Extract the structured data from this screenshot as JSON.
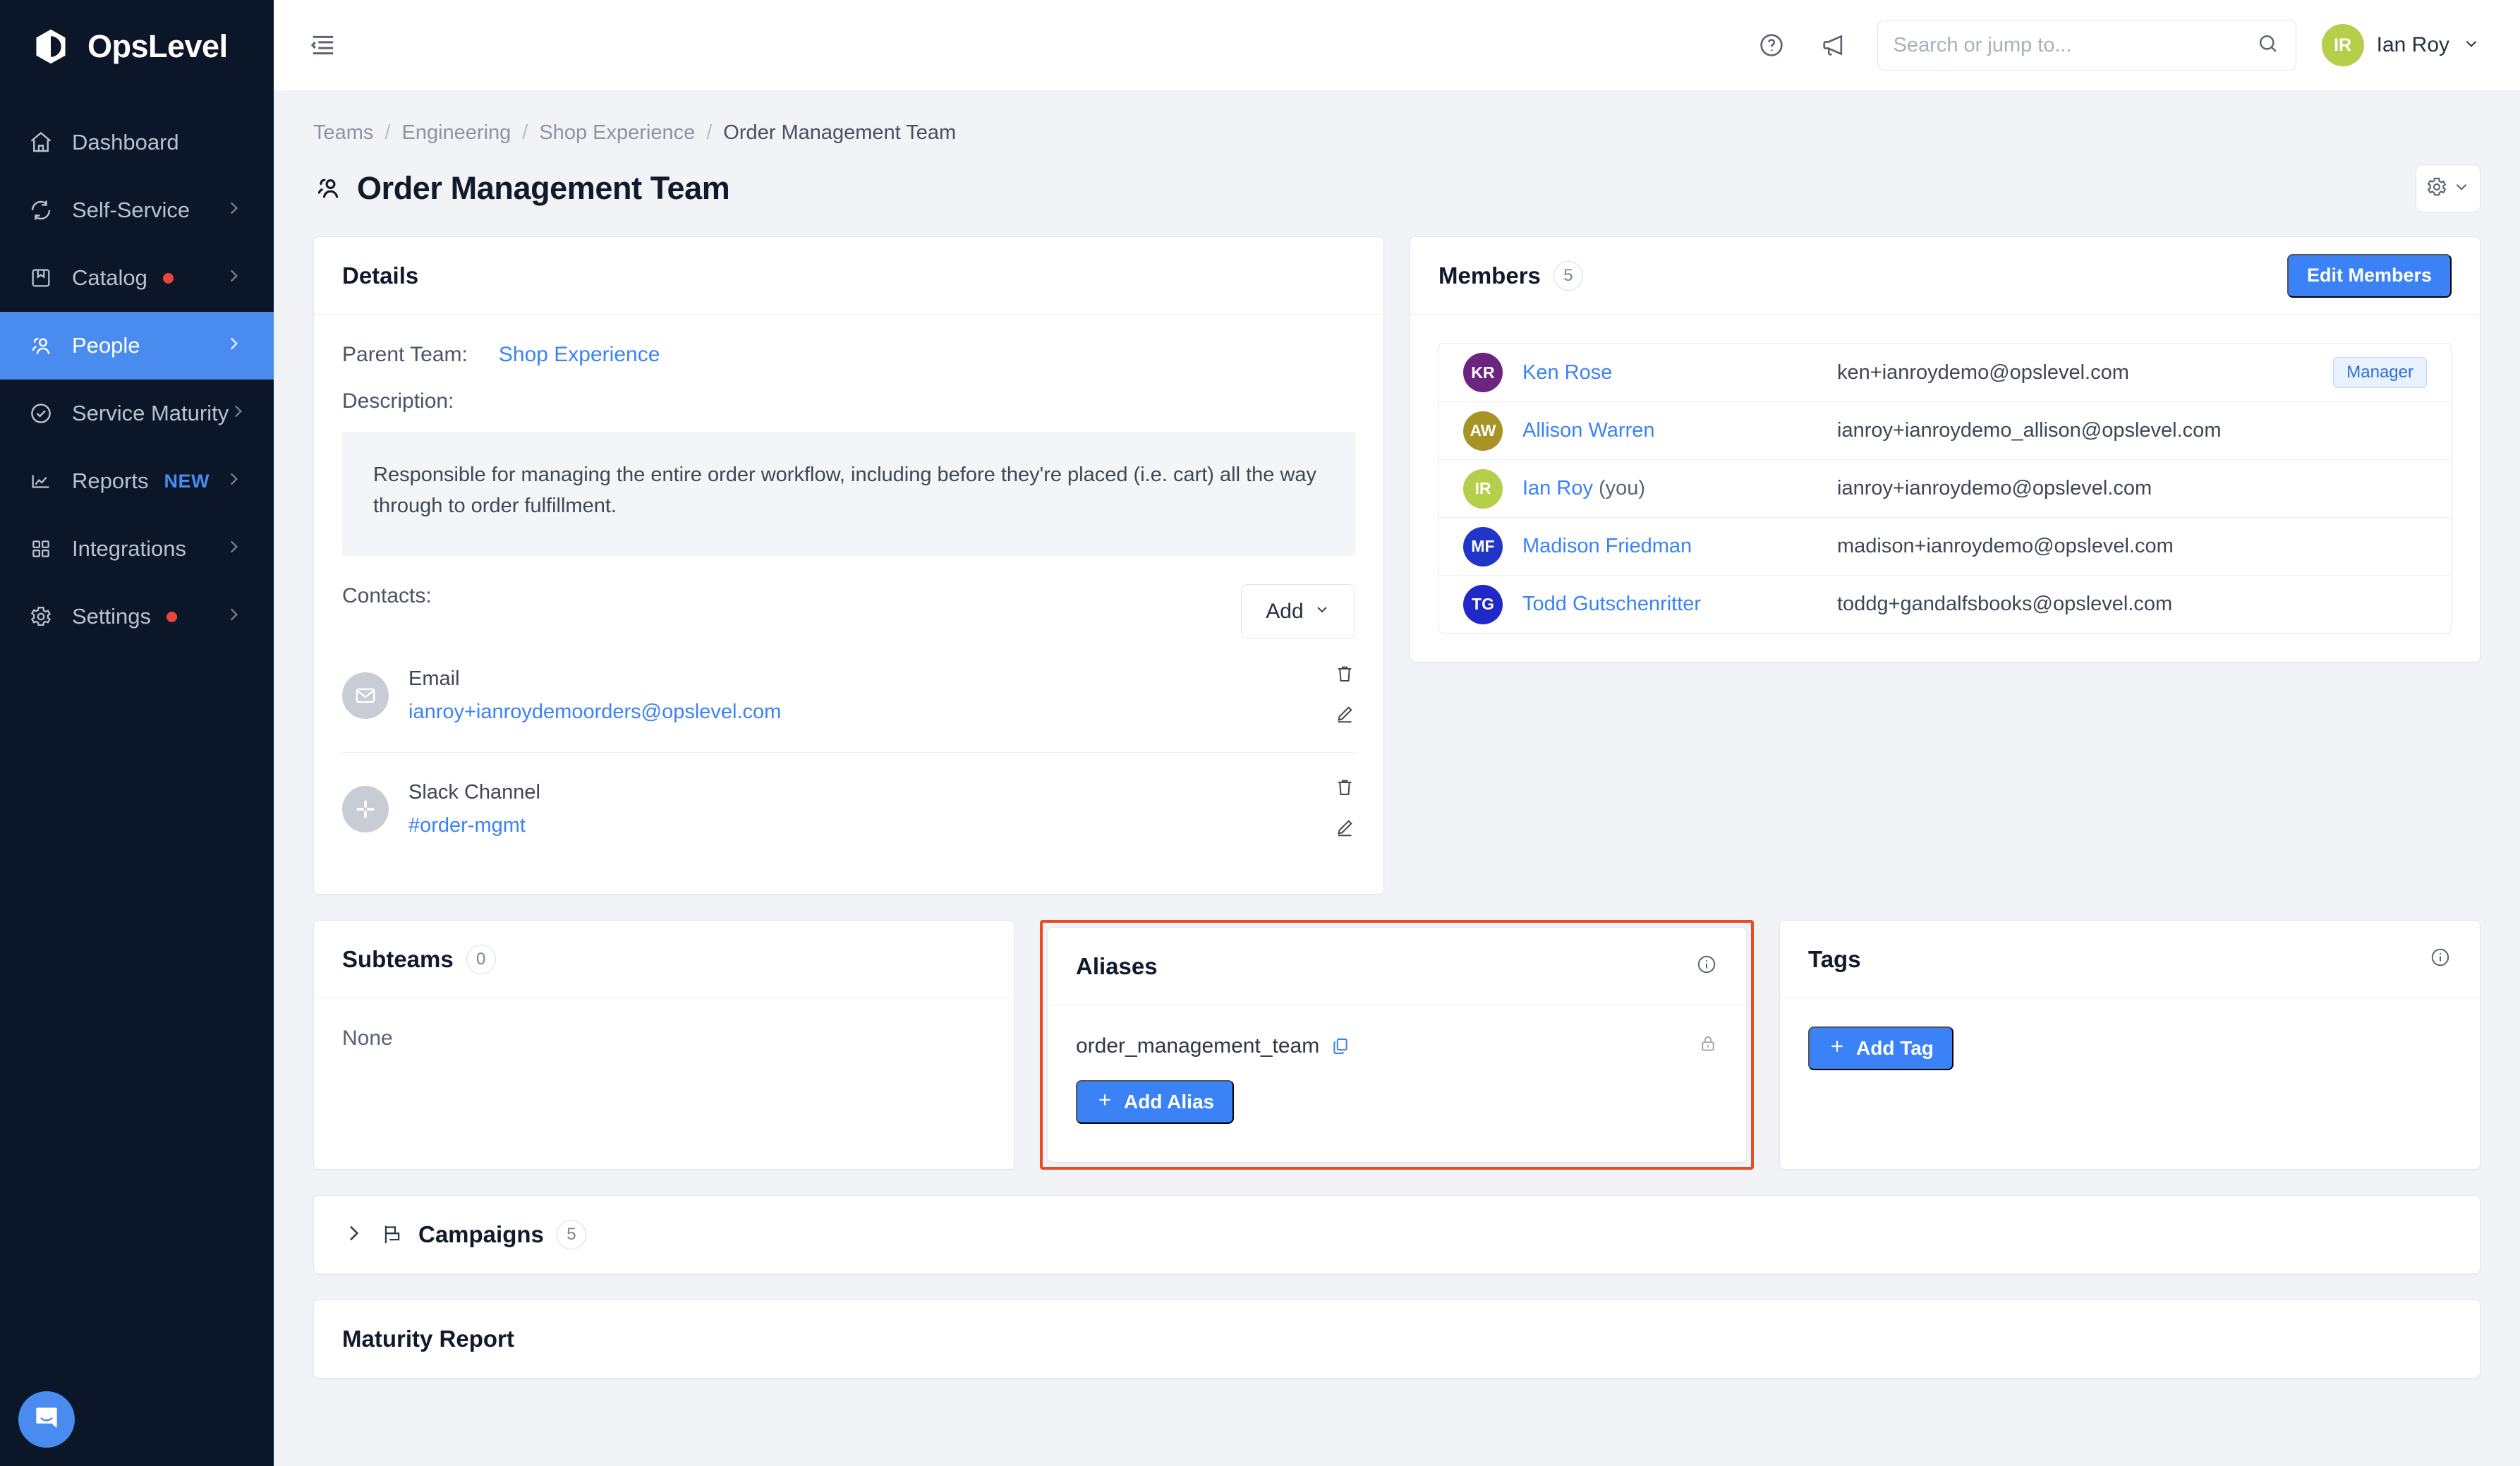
{
  "brand": {
    "name": "OpsLevel",
    "accent": "#4a8bf0",
    "sidebar_bg": "#0b1628"
  },
  "sidebar": {
    "items": [
      {
        "label": "Dashboard",
        "icon": "home-icon",
        "chevron": false,
        "dot": false,
        "badge": "",
        "active": false
      },
      {
        "label": "Self-Service",
        "icon": "refresh-icon",
        "chevron": true,
        "dot": false,
        "badge": "",
        "active": false
      },
      {
        "label": "Catalog",
        "icon": "archive-icon",
        "chevron": true,
        "dot": true,
        "badge": "",
        "active": false
      },
      {
        "label": "People",
        "icon": "people-icon",
        "chevron": true,
        "dot": false,
        "badge": "",
        "active": true
      },
      {
        "label": "Service Maturity",
        "icon": "check-circle-icon",
        "chevron": true,
        "dot": false,
        "badge": "",
        "active": false
      },
      {
        "label": "Reports",
        "icon": "chart-icon",
        "chevron": true,
        "dot": false,
        "badge": "NEW",
        "active": false
      },
      {
        "label": "Integrations",
        "icon": "grid-icon",
        "chevron": true,
        "dot": false,
        "badge": "",
        "active": false
      },
      {
        "label": "Settings",
        "icon": "gear-icon",
        "chevron": true,
        "dot": true,
        "badge": "",
        "active": false
      }
    ],
    "support_bubble": "intercom-chat-icon"
  },
  "topbar": {
    "collapse_icon": "sidebar-collapse-icon",
    "help_icon": "help-circle-icon",
    "announce_icon": "megaphone-icon",
    "search": {
      "placeholder": "Search or jump to...",
      "value": "",
      "icon": "search-icon"
    },
    "user": {
      "initials": "IR",
      "name": "Ian Roy",
      "avatar_color": "#b5cf4a",
      "chevron": "chevron-down-icon"
    }
  },
  "page": {
    "breadcrumb": [
      "Teams",
      "Engineering",
      "Shop Experience",
      "Order Management Team"
    ],
    "separator": "/",
    "title": "Order Management Team",
    "title_icon": "team-icon",
    "settings_button": {
      "icon": "gear-icon",
      "chevron": "chevron-down-icon"
    }
  },
  "details": {
    "title": "Details",
    "parent_team_label": "Parent Team:",
    "parent_team_value": "Shop Experience",
    "description_label": "Description:",
    "description": "Responsible for managing the entire order workflow, including before they're placed (i.e. cart) all the way through to order fulfillment.",
    "contacts_label": "Contacts:",
    "add_button": "Add",
    "contacts": [
      {
        "kind": "Email",
        "value": "ianroy+ianroydemoorders@opslevel.com",
        "icon": "envelope-icon"
      },
      {
        "kind": "Slack Channel",
        "value": "#order-mgmt",
        "icon": "slack-icon"
      }
    ]
  },
  "members": {
    "title": "Members",
    "count": "5",
    "edit_button": "Edit Members",
    "rows": [
      {
        "initials": "KR",
        "color": "#6b2480",
        "name": "Ken Rose",
        "you": "",
        "email": "ken+ianroydemo@opslevel.com",
        "badge": "Manager"
      },
      {
        "initials": "AW",
        "color": "#a89326",
        "name": "Allison Warren",
        "you": "",
        "email": "ianroy+ianroydemo_allison@opslevel.com",
        "badge": ""
      },
      {
        "initials": "IR",
        "color": "#b5cf4a",
        "name": "Ian Roy",
        "you": "(you)",
        "email": "ianroy+ianroydemo@opslevel.com",
        "badge": ""
      },
      {
        "initials": "MF",
        "color": "#2136c8",
        "name": "Madison Friedman",
        "you": "",
        "email": "madison+ianroydemo@opslevel.com",
        "badge": ""
      },
      {
        "initials": "TG",
        "color": "#2128c8",
        "name": "Todd Gutschenritter",
        "you": "",
        "email": "toddg+gandalfsbooks@opslevel.com",
        "badge": ""
      }
    ]
  },
  "subteams": {
    "title": "Subteams",
    "count": "0",
    "empty_text": "None"
  },
  "aliases": {
    "title": "Aliases",
    "info_icon": "info-circle-icon",
    "items": [
      {
        "value": "order_management_team",
        "copy_icon": "copy-icon",
        "lock_icon": "lock-icon"
      }
    ],
    "add_button": "Add Alias",
    "highlight_color": "#ea4b25"
  },
  "tags": {
    "title": "Tags",
    "info_icon": "info-circle-icon",
    "add_button": "Add Tag"
  },
  "campaigns": {
    "title": "Campaigns",
    "count": "5",
    "caret": "chevron-right-icon",
    "icon": "flag-icon"
  },
  "maturity": {
    "title": "Maturity Report"
  }
}
